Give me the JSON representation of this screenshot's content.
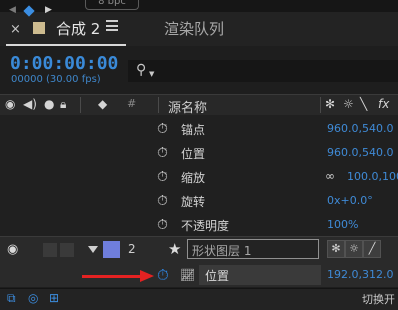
{
  "top_strip": {
    "fragment": "8 bpc"
  },
  "tab": {
    "close": "×",
    "title": "合成 2",
    "render_queue": "渲染队列"
  },
  "time": {
    "timecode": "0:00:00:00",
    "frames": "00000 (30.00 fps)"
  },
  "search": {
    "icon": "search-icon"
  },
  "header": {
    "icons": [
      "eye-icon",
      "audio-icon",
      "solo-icon",
      "lock-icon",
      "label-tag-icon"
    ],
    "hash": "#",
    "source_name": "源名称",
    "switch_icons": [
      "shy-icon",
      "collapse-icon",
      "quality-icon",
      "fx-icon"
    ],
    "fx": "fx"
  },
  "properties": [
    {
      "name": "锚点",
      "value": "960.0,540.0"
    },
    {
      "name": "位置",
      "value": "960.0,540.0"
    },
    {
      "name": "缩放",
      "value": "100.0,100",
      "link": "∞"
    },
    {
      "name": "旋转",
      "value": "0x+0.0°"
    },
    {
      "name": "不透明度",
      "value": "100%"
    }
  ],
  "layer": {
    "number": "2",
    "name": "形状图层 1",
    "color": "#6f7edc"
  },
  "position_row": {
    "label": "位置",
    "value": "192.0,312.0"
  },
  "bottom": {
    "toggle_label": "切换开"
  },
  "colors": {
    "accent_blue": "#3f8ad6",
    "annotation_arrow": "#e42222"
  }
}
